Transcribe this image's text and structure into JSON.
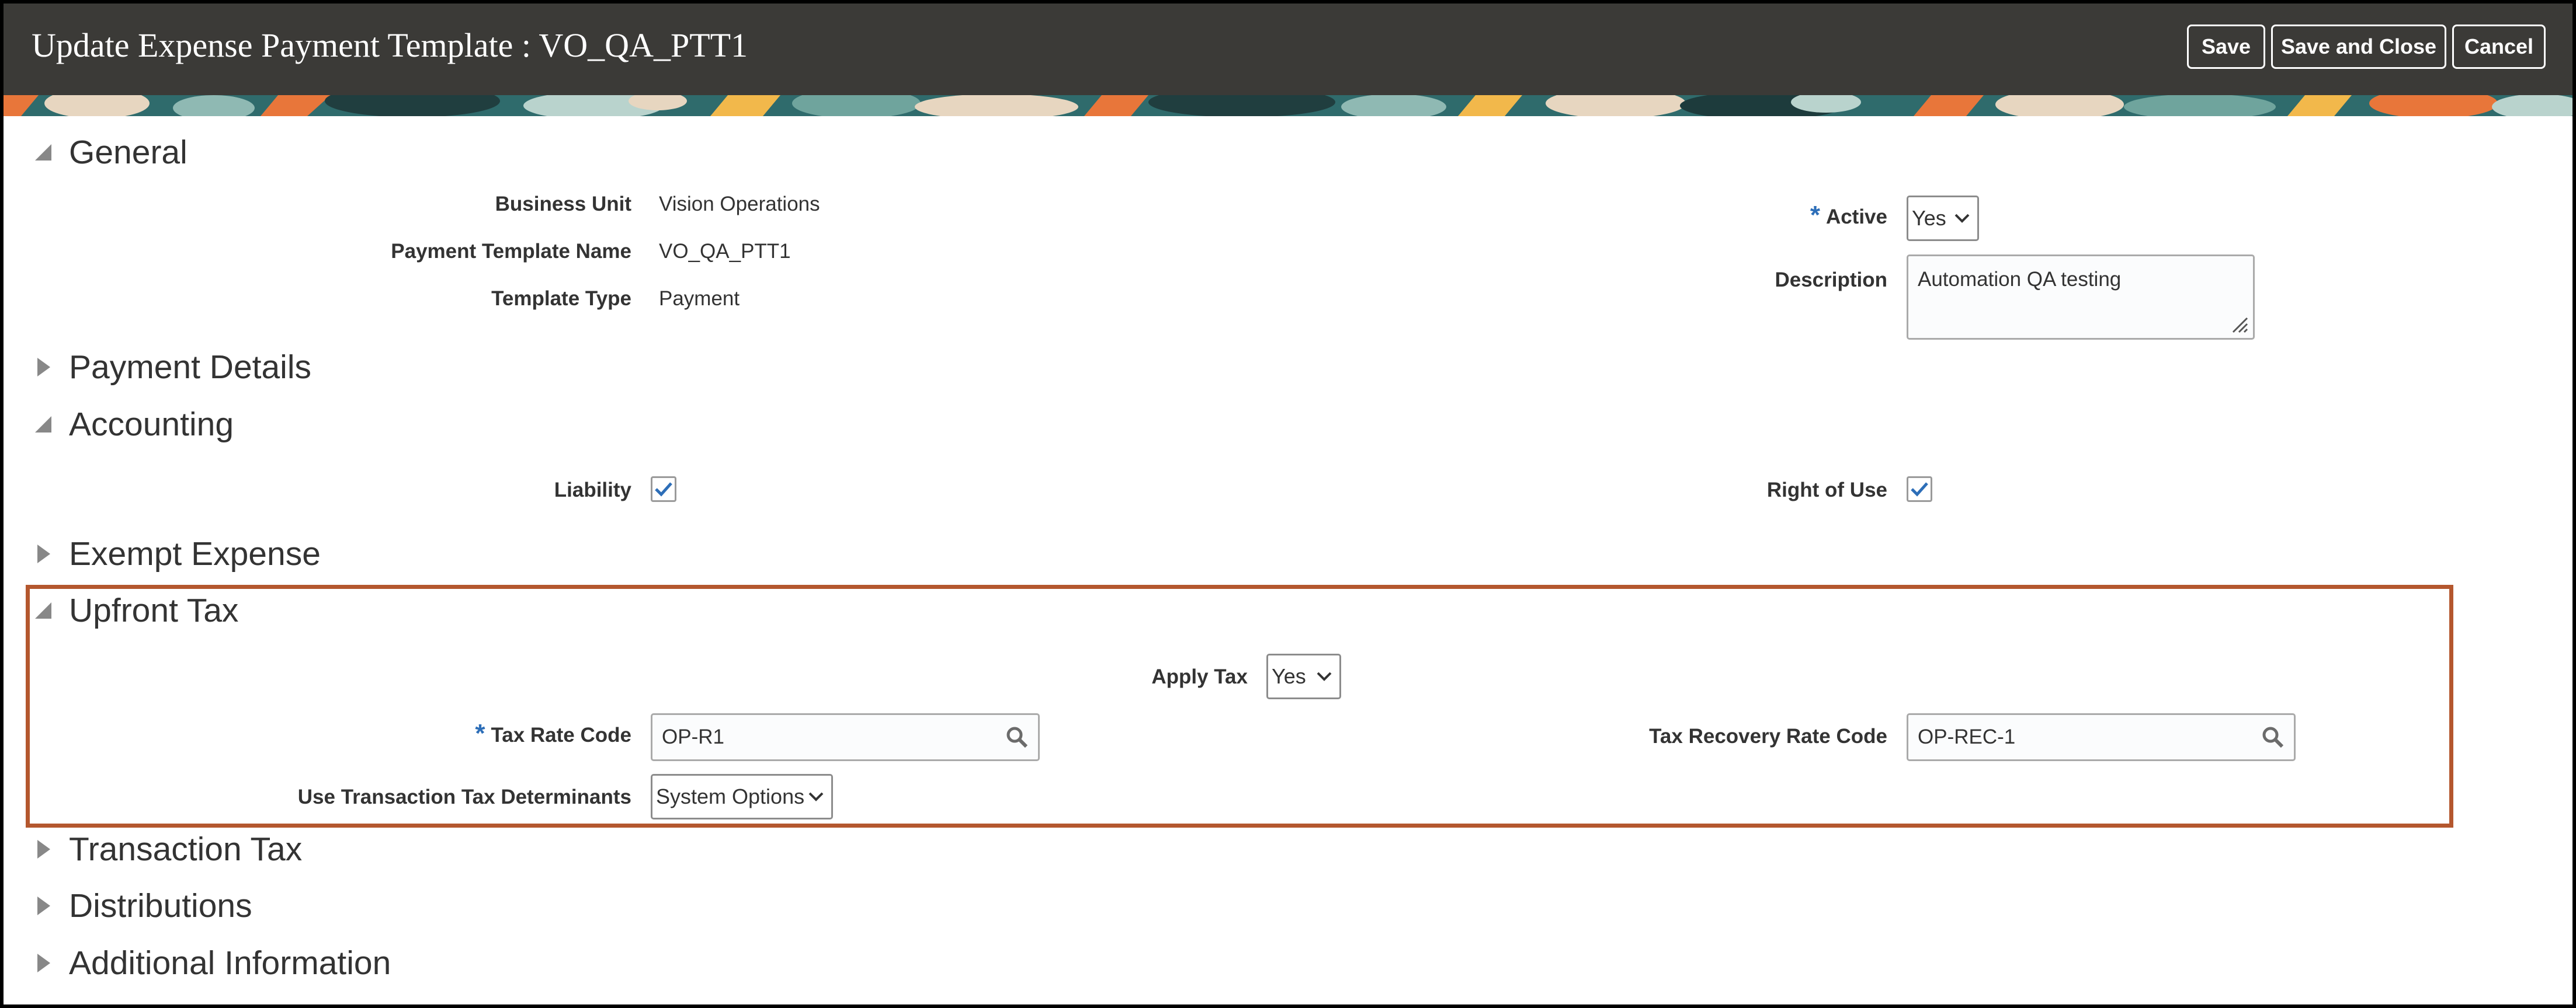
{
  "header": {
    "title": "Update Expense Payment Template : VO_QA_PTT1",
    "buttons": {
      "save": "Save",
      "save_and_close": "Save and Close",
      "cancel": "Cancel"
    }
  },
  "sections": {
    "general": "General",
    "payment_details": "Payment Details",
    "accounting": "Accounting",
    "exempt_expense": "Exempt Expense",
    "upfront_tax": "Upfront Tax",
    "transaction_tax": "Transaction Tax",
    "distributions": "Distributions",
    "additional_information": "Additional Information"
  },
  "general": {
    "business_unit_label": "Business Unit",
    "business_unit_value": "Vision Operations",
    "payment_template_name_label": "Payment Template Name",
    "payment_template_name_value": "VO_QA_PTT1",
    "template_type_label": "Template Type",
    "template_type_value": "Payment",
    "active_label": "Active",
    "active_value": "Yes",
    "description_label": "Description",
    "description_value": "Automation QA testing"
  },
  "accounting": {
    "liability_label": "Liability",
    "liability_checked": true,
    "right_of_use_label": "Right of Use",
    "right_of_use_checked": true
  },
  "upfront_tax": {
    "apply_tax_label": "Apply Tax",
    "apply_tax_value": "Yes",
    "tax_rate_code_label": "Tax Rate Code",
    "tax_rate_code_value": "OP-R1",
    "tax_recovery_rate_code_label": "Tax Recovery Rate Code",
    "tax_recovery_rate_code_value": "OP-REC-1",
    "use_transaction_tax_determinants_label": "Use Transaction Tax Determinants",
    "use_transaction_tax_determinants_value": "System Options"
  },
  "required_marker": "*",
  "colors": {
    "header_bg": "#3b3a37",
    "required": "#2d6eb8",
    "highlight_border": "#b4572e",
    "checkbox_check": "#2d6eb8"
  },
  "icons": [
    "triangle-expanded-icon",
    "triangle-collapsed-icon",
    "search-icon",
    "chevron-down-icon",
    "checkmark-icon",
    "resize-grip-icon"
  ]
}
